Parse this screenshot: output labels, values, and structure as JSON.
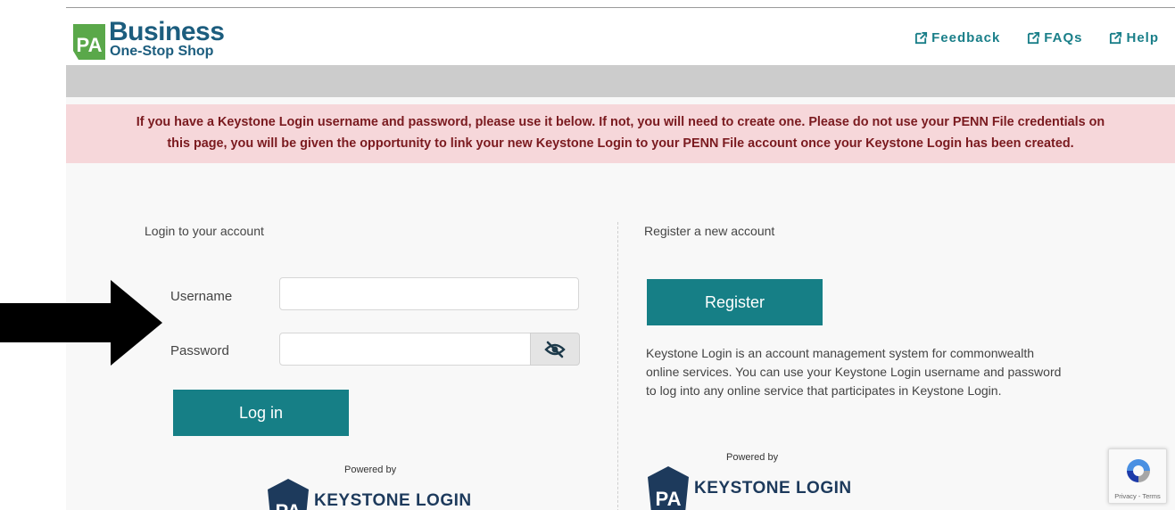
{
  "header": {
    "logo_word1": "Business",
    "logo_word2": "One-Stop Shop",
    "links": [
      {
        "label": "Feedback"
      },
      {
        "label": "FAQs"
      },
      {
        "label": "Help"
      }
    ]
  },
  "alert": {
    "line1": "If you have a Keystone Login username and password, please use it below. If not, you will need to create one. Please do not use your PENN File credentials on",
    "line2": "this page, you will be given the opportunity to link your new Keystone Login to your PENN File account once your Keystone Login has been created."
  },
  "login": {
    "title": "Login to your account",
    "username_label": "Username",
    "password_label": "Password",
    "username_value": "",
    "password_value": "",
    "login_button": "Log in"
  },
  "register": {
    "title": "Register a new account",
    "register_button": "Register",
    "description": "Keystone Login is an account management system for commonwealth online services. You can use your Keystone Login username and password to log into any online service that participates in Keystone Login."
  },
  "powered": {
    "label": "Powered by",
    "brand": "KEYSTONE LOGIN"
  },
  "recaptcha": {
    "text": "Privacy - Terms"
  },
  "colors": {
    "teal": "#167f86",
    "brand_blue": "#1c5d7e",
    "alert_bg": "#f6d7da",
    "alert_text": "#7a1a1f",
    "pa_green": "#5aa84a"
  },
  "icons": {
    "external_link": "external-link-icon",
    "password_toggle": "eye-slash-icon",
    "pa_logo": "pa-keystone-icon",
    "recaptcha": "recaptcha-icon",
    "annotation": "arrow-right-icon"
  }
}
